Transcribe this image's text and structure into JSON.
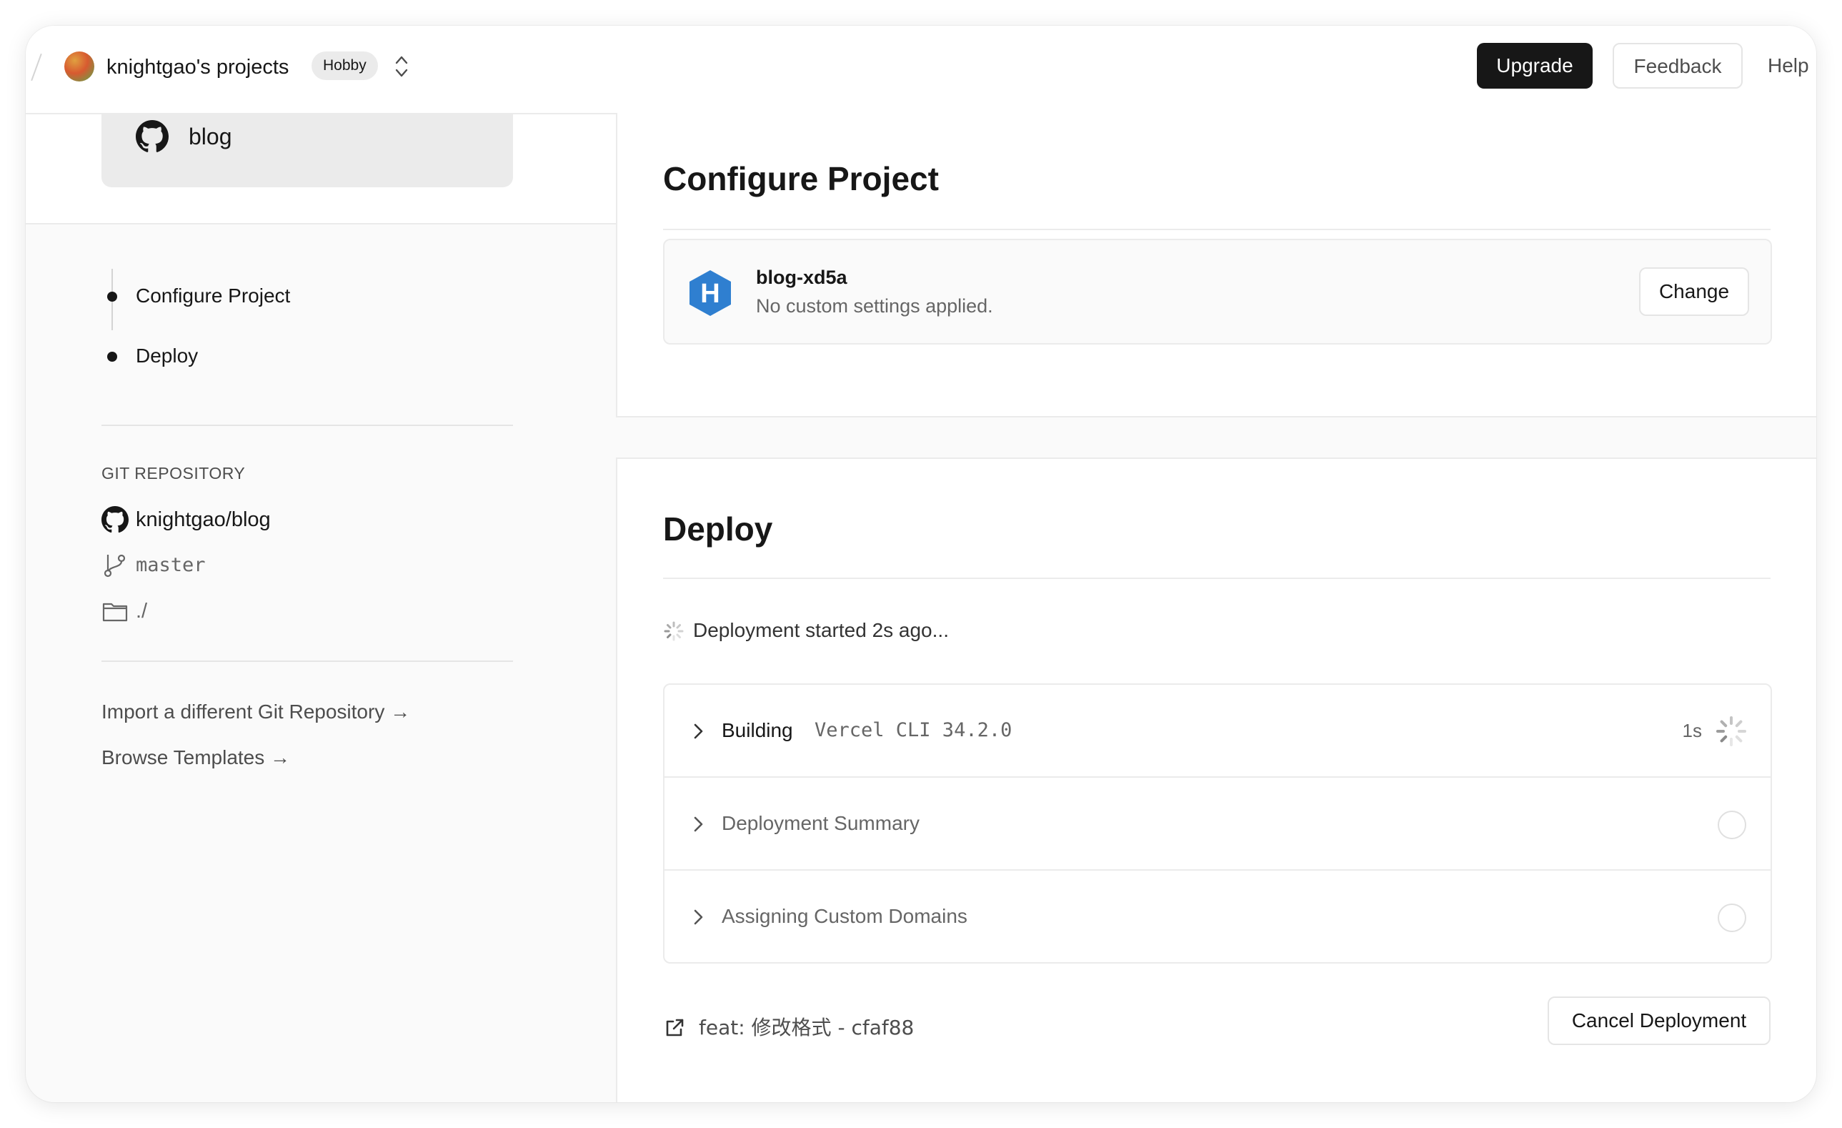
{
  "header": {
    "team_name": "knightgao's projects",
    "plan_badge": "Hobby",
    "upgrade_label": "Upgrade",
    "feedback_label": "Feedback",
    "help_label": "Help"
  },
  "sidebar": {
    "repo_card_name": "blog",
    "steps": [
      {
        "label": "Configure Project"
      },
      {
        "label": "Deploy"
      }
    ],
    "git_heading": "GIT REPOSITORY",
    "repo_full_name": "knightgao/blog",
    "branch": "master",
    "root_dir": "./",
    "links": [
      {
        "label": "Import a different Git Repository →"
      },
      {
        "label": "Browse Templates →"
      }
    ]
  },
  "configure": {
    "title": "Configure Project",
    "project_name": "blog-xd5a",
    "project_desc": "No custom settings applied.",
    "change_label": "Change",
    "framework_icon": "hexo-icon",
    "framework_letter": "H"
  },
  "deploy": {
    "title": "Deploy",
    "status_text": "Deployment started 2s ago...",
    "steps": [
      {
        "name": "Building",
        "detail": "Vercel CLI 34.2.0",
        "time": "1s",
        "state": "running"
      },
      {
        "name": "Deployment Summary",
        "state": "pending"
      },
      {
        "name": "Assigning Custom Domains",
        "state": "pending"
      }
    ],
    "commit_text": "feat: 修改格式 - cfaf88",
    "cancel_label": "Cancel Deployment"
  },
  "colors": {
    "primary_text": "#171717",
    "muted_text": "#666666",
    "border": "#ebebeb",
    "framework_blue": "#2f7fd0"
  }
}
